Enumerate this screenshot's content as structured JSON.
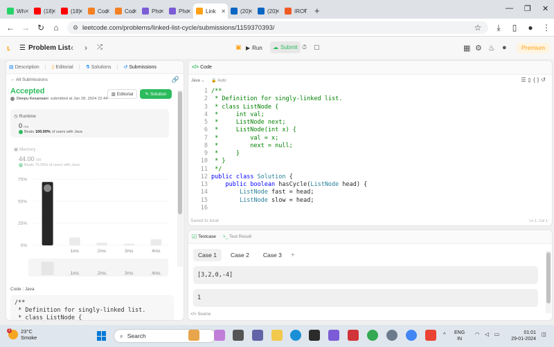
{
  "browser": {
    "tabs": [
      {
        "label": "Wh",
        "color": "#25d366"
      },
      {
        "label": "(18)",
        "color": "#ff0000"
      },
      {
        "label": "(18)",
        "color": "#ff0000"
      },
      {
        "label": "Cod",
        "color": "#f48024"
      },
      {
        "label": "Cod",
        "color": "#f48024"
      },
      {
        "label": "Pho",
        "color": "#7b5cd6"
      },
      {
        "label": "Pho",
        "color": "#7b5cd6"
      },
      {
        "label": "Link",
        "color": "#ffa116"
      },
      {
        "label": "(20)",
        "color": "#0a66c2"
      },
      {
        "label": "(20)",
        "color": "#0a66c2"
      },
      {
        "label": "IRCT",
        "color": "#f15a24"
      }
    ],
    "url": "leetcode.com/problems/linked-list-cycle/submissions/1159370393/"
  },
  "lc_nav": {
    "problem_list": "Problem List",
    "run": "Run",
    "submit": "Submit",
    "premium": "Premium"
  },
  "left": {
    "tabs": [
      "Description",
      "Editorial",
      "Solutions",
      "Submissions"
    ],
    "all_submissions": "All Submissions",
    "status": "Accepted",
    "author": "Deepu Kesarwani",
    "submitted": "submitted at Jan 28, 2024 22:44",
    "editorial_btn": "Editorial",
    "solution_btn": "Solution",
    "runtime": {
      "label": "Runtime",
      "value": "0",
      "unit": "ms",
      "beats_prefix": "Beats",
      "beats_pct": "100.00%",
      "beats_suffix": "of users with Java"
    },
    "memory": {
      "label": "Memory",
      "value": "44.00",
      "unit": "MB",
      "beats_text": "Beats 79.05% of users with Java"
    },
    "code_label": "Code",
    "code_lang": "Java",
    "code_preview": "/**\n * Definition for singly-linked list.\n * class ListNode {"
  },
  "chart_data": {
    "type": "bar",
    "categories": [
      "",
      "1ms",
      "2ms",
      "3ms",
      "4ms"
    ],
    "values": [
      72,
      9,
      3,
      2,
      7
    ],
    "y_ticks": [
      "75%",
      "50%",
      "25%",
      "0%"
    ],
    "ylim": [
      0,
      80
    ],
    "highlight_index": 0,
    "mini_categories": [
      "",
      "1ms",
      "2ms",
      "3ms",
      "4ms"
    ],
    "mini_values": [
      70,
      4,
      3,
      2,
      4
    ]
  },
  "code": {
    "tab": "Code",
    "lang": "Java",
    "mode": "Auto",
    "lines": [
      "/**",
      " * Definition for singly-linked list.",
      " * class ListNode {",
      " *     int val;",
      " *     ListNode next;",
      " *     ListNode(int x) {",
      " *         val = x;",
      " *         next = null;",
      " *     }",
      " * }",
      " */",
      "public class Solution {",
      "    public boolean hasCycle(ListNode head) {",
      "        ListNode fast = head;",
      "        ListNode slow = head;",
      ""
    ],
    "saved": "Saved to local",
    "cursor": "Ln 1, Col 1"
  },
  "testcase": {
    "tab_active": "Testcase",
    "tab_result": "Test Result",
    "cases": [
      "Case 1",
      "Case 2",
      "Case 3"
    ],
    "add": "+",
    "input1": "[3,2,0,-4]",
    "input2": "1",
    "source": "Source"
  },
  "taskbar": {
    "temp": "23°C",
    "weather": "Smoke",
    "badge": "1",
    "search": "Search",
    "lang1": "ENG",
    "lang2": "IN",
    "time": "01:01",
    "date": "29-01-2024"
  }
}
